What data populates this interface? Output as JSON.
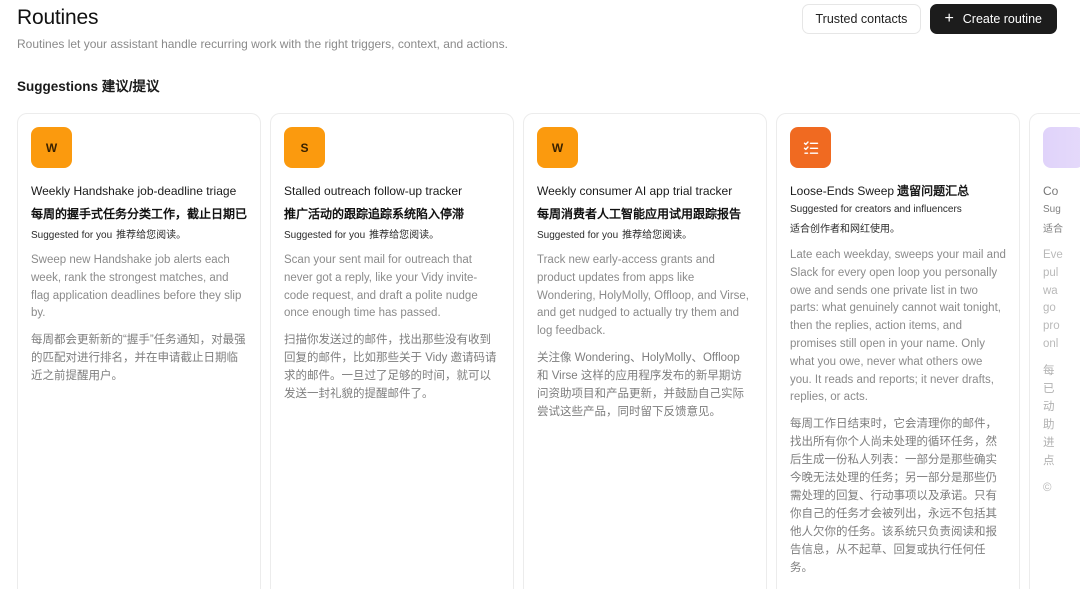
{
  "header": {
    "title": "Routines",
    "subtitle": "Routines let your assistant handle recurring work with the right triggers, context, and actions."
  },
  "actions": {
    "trusted_contacts": "Trusted contacts",
    "create_routine": "Create routine"
  },
  "suggestions": {
    "heading": "Suggestions  建议/提议",
    "cards": [
      {
        "avatar": "W",
        "title": "Weekly Handshake job-deadline triage",
        "title_zh": "每周的握手式任务分类工作，截止日期已",
        "suggested": "Suggested for you",
        "suggested_zh": "推荐给您阅读。",
        "description": "Sweep new Handshake job alerts each week, rank the strongest matches, and flag application deadlines before they slip by.",
        "description_zh": "每周都会更新新的“握手”任务通知，对最强的匹配对进行排名，并在申请截止日期临近之前提醒用户。"
      },
      {
        "avatar": "S",
        "title": "Stalled outreach follow-up tracker",
        "title_zh": "推广活动的跟踪追踪系统陷入停滞",
        "suggested": "Suggested for you",
        "suggested_zh": "推荐给您阅读。",
        "description": "Scan your sent mail for outreach that never got a reply, like your Vidy invite-code request, and draft a polite nudge once enough time has passed.",
        "description_zh": "扫描你发送过的邮件，找出那些没有收到回复的邮件，比如那些关于 Vidy 邀请码请求的邮件。一旦过了足够的时间，就可以发送一封礼貌的提醒邮件了。"
      },
      {
        "avatar": "W",
        "title": "Weekly consumer AI app trial tracker",
        "title_zh": "每周消费者人工智能应用试用跟踪报告",
        "suggested": "Suggested for you",
        "suggested_zh": "推荐给您阅读。",
        "description": "Track new early-access grants and product updates from apps like Wondering, HolyMolly, Offloop, and Virse, and get nudged to actually try them and log feedback.",
        "description_zh": "关注像 Wondering、HolyMolly、Offloop 和 Virse 这样的应用程序发布的新早期访问资助项目和产品更新，并鼓励自己实际尝试这些产品，同时留下反馈意见。"
      },
      {
        "avatar_icon": "checklist-icon",
        "title": "Loose-Ends Sweep",
        "title_zh_inline": "遗留问题汇总",
        "suggested": "Suggested for creators and influencers",
        "suggested_zh": "适合创作者和网红使用。",
        "description": "Late each weekday, sweeps your mail and Slack for every open loop you personally owe and sends one private list in two parts: what genuinely cannot wait tonight, then the replies, action items, and promises still open in your name. Only what you owe, never what others owe you. It reads and reports; it never drafts, replies, or acts.",
        "description_zh": "每周工作日结束时，它会清理你的邮件，找出所有你个人尚未处理的循环任务，然后生成一份私人列表：一部分是那些确实今晚无法处理的任务；另一部分是那些仍需处理的回复、行动事项以及承诺。只有你自己的任务才会被列出，永远不包括其他人欠你的任务。该系统只负责阅读和报告信息，从不起草、回复或执行任何任务。"
      },
      {
        "title": "Co",
        "suggested": "Sug",
        "suggested_zh": "适合",
        "description": "Eve pul wa go pro onl",
        "description_zh": "每 已 动 助 进 点",
        "footer_mark": "©"
      }
    ]
  }
}
